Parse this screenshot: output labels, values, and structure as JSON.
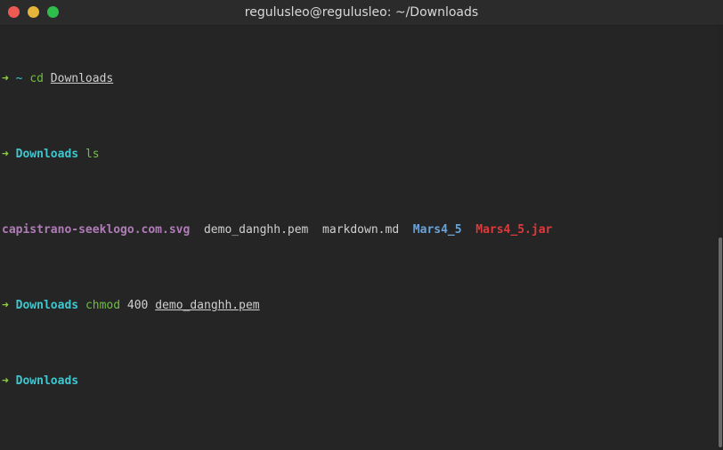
{
  "window": {
    "title": "regulusleo@regulusleo: ~/Downloads",
    "buttons": {
      "close_color": "#ed5a54",
      "minimize_color": "#e6b33b",
      "maximize_color": "#2fbd4b"
    }
  },
  "colors": {
    "background": "#252525",
    "prompt_arrow": "#8fd13b",
    "directory": "#3fc6cf",
    "command": "#6fbf3f",
    "text": "#d0d0d0",
    "svg_file": "#b07cb8",
    "dir_listing": "#6aa3d8",
    "jar_file": "#e0393b"
  },
  "terminal": {
    "lines": [
      {
        "arrow": "➜",
        "cwd": "~",
        "command": "cd",
        "args": [
          {
            "text": "Downloads",
            "underline": true
          }
        ]
      },
      {
        "arrow": "➜",
        "cwd": "Downloads",
        "command": "ls",
        "args": []
      },
      {
        "listing": [
          {
            "name": "capistrano-seeklogo.com.svg",
            "kind": "svg"
          },
          {
            "name": "demo_danghh.pem",
            "kind": "file"
          },
          {
            "name": "markdown.md",
            "kind": "file"
          },
          {
            "name": "Mars4_5",
            "kind": "dir"
          },
          {
            "name": "Mars4_5.jar",
            "kind": "jar"
          }
        ]
      },
      {
        "arrow": "➜",
        "cwd": "Downloads",
        "command": "chmod",
        "args": [
          {
            "text": "400",
            "underline": false
          },
          {
            "text": "demo_danghh.pem",
            "underline": true
          }
        ]
      },
      {
        "arrow": "➜",
        "cwd": "Downloads",
        "command": "",
        "args": []
      }
    ]
  }
}
